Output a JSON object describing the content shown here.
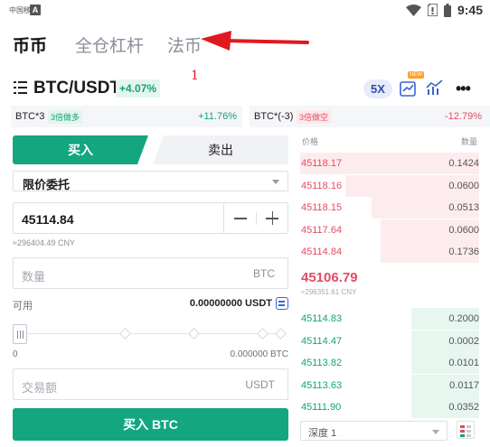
{
  "status_bar": {
    "carrier": "中国移",
    "app_icon": "A",
    "time": "9:45",
    "icons": [
      "wifi-icon",
      "sim-icon",
      "battery-icon"
    ]
  },
  "top_tabs": [
    {
      "label": "币币",
      "active": true
    },
    {
      "label": "全仓杠杆",
      "active": false
    },
    {
      "label": "法币",
      "active": false
    }
  ],
  "annotation": {
    "number": "1",
    "color": "#e0191f"
  },
  "pair": {
    "name": "BTC/USDT",
    "change": "+4.07%",
    "leverage": "5X",
    "new_badge": "NEW"
  },
  "tokens": [
    {
      "name": "BTC*3",
      "tag": "3倍做多",
      "change": "+11.76%",
      "direction": "up"
    },
    {
      "name": "BTC*(-3)",
      "tag": "3倍做空",
      "change": "-12.79%",
      "direction": "down"
    }
  ],
  "trade_form": {
    "buy_tab": "买入",
    "sell_tab": "卖出",
    "order_type": "限价委托",
    "price_value": "45114.84",
    "price_cny": "≈296404.49 CNY",
    "amount_placeholder": "数量",
    "amount_unit": "BTC",
    "available_label": "可用",
    "available_value": "0.00000000 USDT",
    "slider_min": "0",
    "slider_max": "0.000000 BTC",
    "total_placeholder": "交易额",
    "total_unit": "USDT",
    "submit_label": "买入 BTC"
  },
  "order_book": {
    "price_header": "价格",
    "qty_header": "数量",
    "asks": [
      {
        "price": "45118.17",
        "qty": "0.1424",
        "depth": 1.0
      },
      {
        "price": "45118.16",
        "qty": "0.0600",
        "depth": 0.75
      },
      {
        "price": "45118.15",
        "qty": "0.0513",
        "depth": 0.6
      },
      {
        "price": "45117.64",
        "qty": "0.0600",
        "depth": 0.55
      },
      {
        "price": "45114.84",
        "qty": "0.1736",
        "depth": 0.55
      }
    ],
    "last_price": "45106.79",
    "last_price_cny": "≈296351.61 CNY",
    "bids": [
      {
        "price": "45114.83",
        "qty": "0.2000",
        "depth": 0.38
      },
      {
        "price": "45114.47",
        "qty": "0.0002",
        "depth": 0.38
      },
      {
        "price": "45113.82",
        "qty": "0.0101",
        "depth": 0.38
      },
      {
        "price": "45113.63",
        "qty": "0.0117",
        "depth": 0.38
      },
      {
        "price": "45111.90",
        "qty": "0.0352",
        "depth": 0.38
      }
    ],
    "depth_label": "深度 1"
  }
}
